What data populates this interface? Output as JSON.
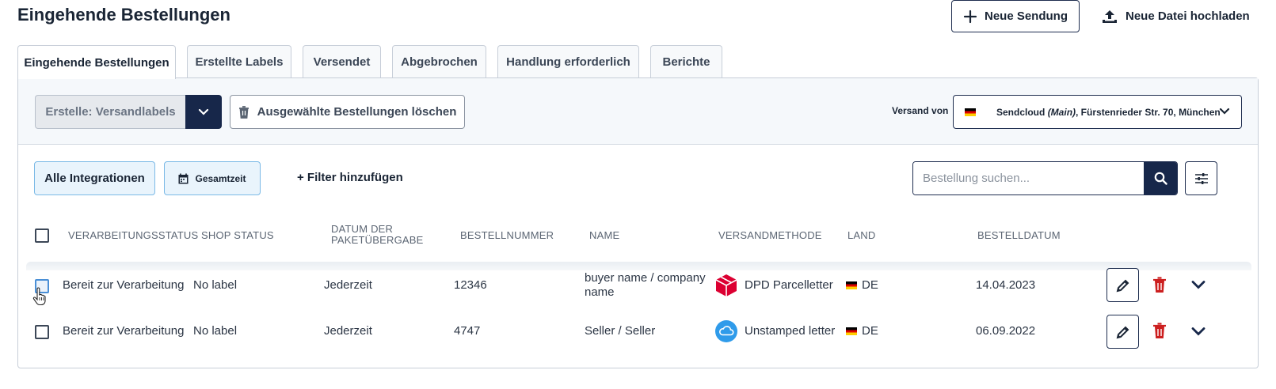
{
  "header": {
    "title": "Eingehende Bestellungen",
    "new_shipment_label": "Neue Sendung",
    "upload_label": "Neue Datei hochladen"
  },
  "tabs": [
    {
      "label": "Eingehende Bestellungen",
      "active": true
    },
    {
      "label": "Erstellte Labels"
    },
    {
      "label": "Versendet"
    },
    {
      "label": "Abgebrochen"
    },
    {
      "label": "Handlung erforderlich"
    },
    {
      "label": "Berichte"
    }
  ],
  "toolbar": {
    "create_label": "Erstelle: Versandlabels",
    "delete_selected_label": "Ausgewählte Bestellungen löschen",
    "ship_from_label": "Versand von",
    "ship_from_name": "Sendcloud",
    "ship_from_main": "(Main)",
    "ship_from_address": ", Fürstenrieder Str. 70, München"
  },
  "filters": {
    "integrations_label": "Alle Integrationen",
    "period_label": "Gesamtzeit",
    "add_filter_label": "+ Filter hinzufügen",
    "search_placeholder": "Bestellung suchen..."
  },
  "table": {
    "headers": {
      "processing_status": "VERARBEITUNGSSTATUS",
      "shop_status": "SHOP STATUS",
      "handover_date_line1": "DATUM DER",
      "handover_date_line2": "PAKETÜBERGABE",
      "order_number": "BESTELLNUMMER",
      "name": "NAME",
      "shipping_method": "VERSANDMETHODE",
      "country": "LAND",
      "order_date": "BESTELLDATUM"
    },
    "rows": [
      {
        "processing_status": "Bereit zur Verarbeitung",
        "shop_status": "No label",
        "handover_date": "Jederzeit",
        "order_number": "12346",
        "name_line1": "buyer name / company",
        "name_line2": "name",
        "shipping_method": "DPD Parcelletter",
        "carrier_icon": "dpd-logo-icon",
        "country": "DE",
        "order_date": "14.04.2023"
      },
      {
        "processing_status": "Bereit zur Verarbeitung",
        "shop_status": "No label",
        "handover_date": "Jederzeit",
        "order_number": "4747",
        "name_line1": "Seller / Seller",
        "shipping_method": "Unstamped letter",
        "carrier_icon": "cloud-icon",
        "country": "DE",
        "order_date": "06.09.2022"
      }
    ]
  },
  "colors": {
    "navy": "#17274a",
    "danger": "#cc1f1f",
    "chip_bg": "#e9f4fc",
    "dpd_red": "#dc0032",
    "cloud_blue": "#2f9bea"
  }
}
